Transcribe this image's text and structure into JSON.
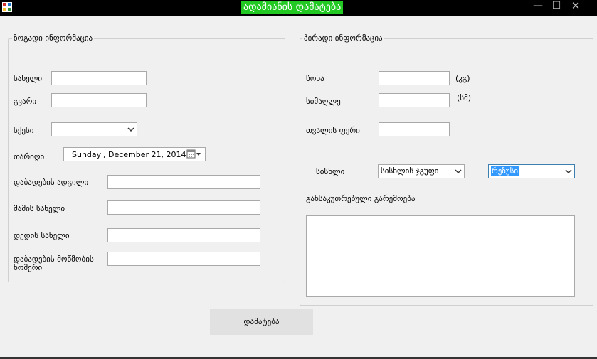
{
  "window": {
    "title": "ადამიანის დამატება",
    "minimize": "—",
    "maximize": "☐",
    "close": "✕"
  },
  "general_info": {
    "legend": "ზოგადი ინფორმაცია",
    "first_name_label": "სახელი",
    "first_name_value": "",
    "last_name_label": "გვარი",
    "last_name_value": "",
    "gender_label": "სქესი",
    "gender_value": "",
    "date_label": "თარიღი",
    "date_day": "Sunday",
    "date_rest": ",  December 21, 2014",
    "birthplace_label": "დაბადების ადგილი",
    "birthplace_value": "",
    "father_name_label": "მამის სახელი",
    "father_name_value": "",
    "mother_name_label": "დედის სახელი",
    "mother_name_value": "",
    "birth_cert_label": "დაბადების მოწმობის ნომერი",
    "birth_cert_value": ""
  },
  "personal_info": {
    "legend": "პირადი ინფორმაცია",
    "weight_label": "წონა",
    "weight_value": "",
    "weight_unit": "(კგ)",
    "height_label": "სიმაღლე",
    "height_value": "",
    "height_unit": "(სმ)",
    "eye_color_label": "თვალის ფერი",
    "eye_color_value": "",
    "blood_label": "სისხლი",
    "blood_group_value": "სისხლის ჯგუფი",
    "rhesus_value": "რეზუსი",
    "special_marks_label": "განსაკუთრებული გარემოება",
    "special_marks_value": ""
  },
  "actions": {
    "add_label": "დამატება"
  },
  "colors": {
    "title_highlight": "#22c922",
    "selection": "#3399ff"
  }
}
